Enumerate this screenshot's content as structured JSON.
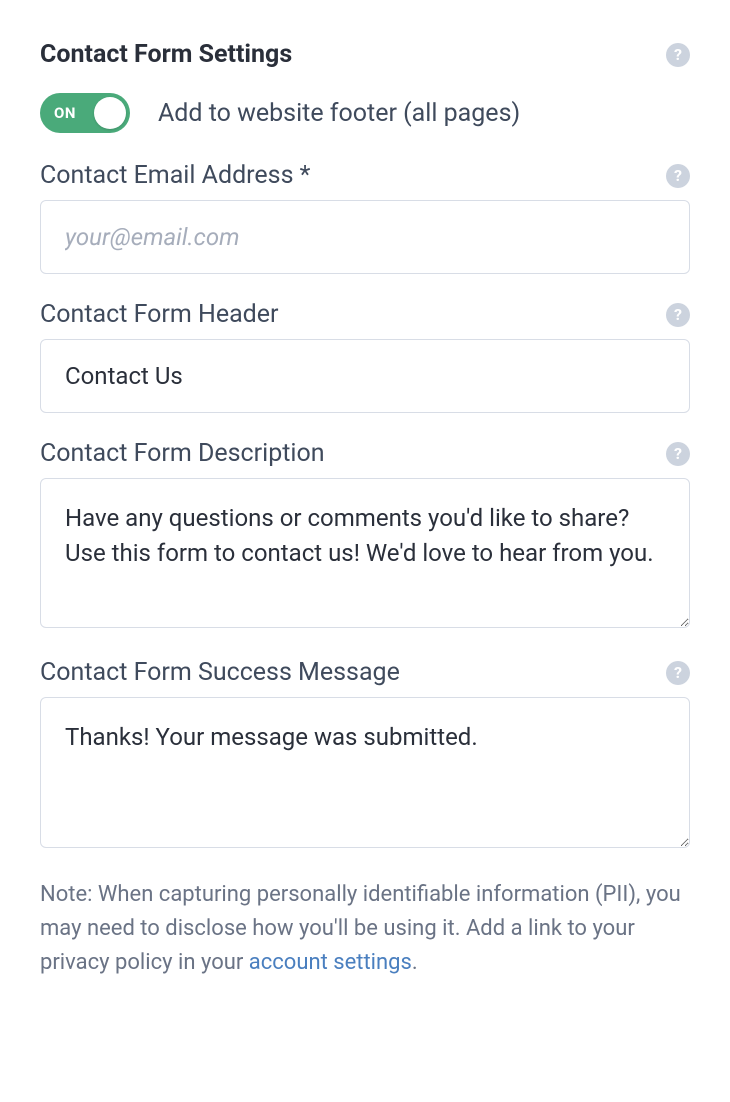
{
  "header": {
    "title": "Contact Form Settings"
  },
  "toggle": {
    "state_label": "ON",
    "description": "Add to website footer (all pages)"
  },
  "fields": {
    "email": {
      "label": "Contact Email Address *",
      "placeholder": "your@email.com",
      "value": ""
    },
    "form_header": {
      "label": "Contact Form Header",
      "value": "Contact Us"
    },
    "form_description": {
      "label": "Contact Form Description",
      "value": "Have any questions or comments you'd like to share? Use this form to contact us! We'd love to hear from you."
    },
    "success_message": {
      "label": "Contact Form Success Message",
      "value": "Thanks! Your message was submitted."
    }
  },
  "note": {
    "prefix": "Note: When capturing personally identifiable information (PII), you may need to disclose how you'll be using it. Add a link to your privacy policy in your ",
    "link_text": "account settings",
    "suffix": "."
  }
}
